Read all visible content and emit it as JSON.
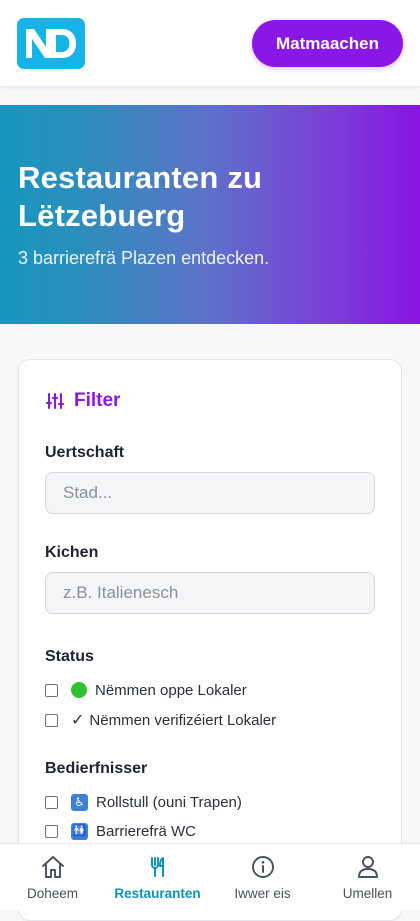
{
  "header": {
    "logo_text": "ND",
    "cta_label": "Matmaachen"
  },
  "hero": {
    "title": "Restauranten zu Lëtzebuerg",
    "subtitle": "3 barrierefrä Plazen entdecken."
  },
  "filter": {
    "title": "Filter",
    "location": {
      "label": "Uertschaft",
      "placeholder": "Stad...",
      "value": ""
    },
    "cuisine": {
      "label": "Kichen",
      "placeholder": "z.B. Italienesch",
      "value": ""
    },
    "status": {
      "label": "Status",
      "options": [
        {
          "label": "Nëmmen oppe Lokaler",
          "icon": "green-circle-icon",
          "checked": false
        },
        {
          "label": "Nëmmen verifizéiert Lokaler",
          "icon": "check-mark-icon",
          "checked": false
        }
      ]
    },
    "needs": {
      "label": "Bedierfnisser",
      "options": [
        {
          "label": "Rollstull (ouni Trapen)",
          "icon": "wheelchair-icon",
          "checked": false
        },
        {
          "label": "Barrierefrä WC",
          "icon": "restroom-icon",
          "checked": false
        }
      ]
    },
    "glyphs": {
      "check": "✓",
      "wheelchair": "♿",
      "restroom": "🚻"
    }
  },
  "nav": {
    "items": [
      {
        "label": "Doheem",
        "icon": "home-icon",
        "active": false
      },
      {
        "label": "Restauranten",
        "icon": "utensils-icon",
        "active": true
      },
      {
        "label": "Iwwer eis",
        "icon": "info-icon",
        "active": false
      },
      {
        "label": "Umellen",
        "icon": "user-icon",
        "active": false
      }
    ]
  },
  "colors": {
    "brand_purple": "#8a17e6",
    "logo_blue": "#16b4e6",
    "nav_active": "#0d93b8",
    "hero_gradient_start": "#1697bf",
    "hero_gradient_end": "#8a14e2"
  }
}
